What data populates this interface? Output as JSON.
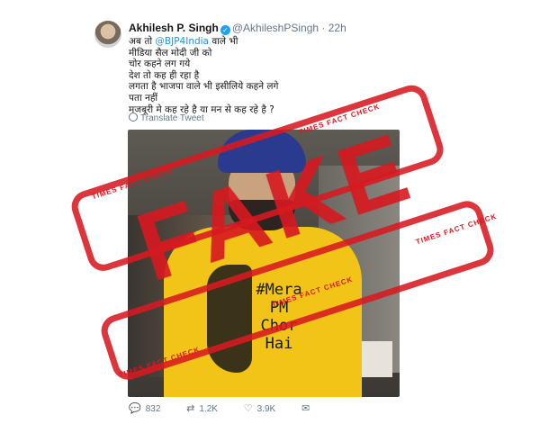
{
  "tweet": {
    "author": "Akhilesh P. Singh",
    "handle": "@AkhileshPSingh",
    "time": "· 22h",
    "lines": [
      "अब तो ",
      "@BJP4India",
      " वाले भी",
      "मीडिया सैल मोदी जी को",
      "चोर कहने लग गये",
      "देश तो कह ही रहा है",
      "लगता है भाजपा वाले भी इसीलिये कहने लगे",
      "पता नहीं",
      "मजबूरी मे कह रहे है या मन से कह रहे है ?"
    ],
    "translate": "Translate Tweet",
    "shirt_text": [
      "#Mera",
      "PM",
      "Chor",
      "Hai"
    ],
    "actions": {
      "replies": "832",
      "retweets": "1.2K",
      "likes": "3.9K"
    }
  },
  "overlay": {
    "stamp": "FAKE",
    "watermark": "TIMES FACT CHECK",
    "color": "#d71920"
  },
  "colors": {
    "link": "#1b95e0",
    "verified": "#1da1f2",
    "muted": "#657786"
  }
}
